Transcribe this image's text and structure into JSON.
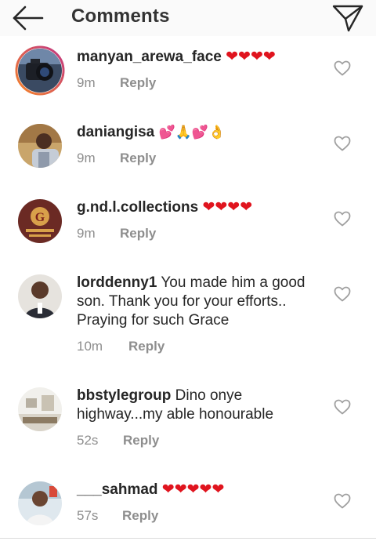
{
  "header": {
    "title": "Comments",
    "back_icon": "arrow-left-icon",
    "send_icon": "paper-plane-icon"
  },
  "colors": {
    "heart": "#e0141e",
    "meta": "#8e8e8e",
    "text": "#262626",
    "story_ring_start": "#f58529",
    "story_ring_end": "#c13584"
  },
  "comments": [
    {
      "username": "manyan_arewa_face",
      "text": "",
      "emoji": "❤❤❤❤",
      "time": "9m",
      "reply_label": "Reply",
      "has_story_ring": true
    },
    {
      "username": "daniangisa",
      "text": "",
      "emoji": "💕🙏💕👌",
      "time": "9m",
      "reply_label": "Reply"
    },
    {
      "username": "g.nd.l.collections",
      "text": "",
      "emoji": "❤❤❤❤",
      "time": "9m",
      "reply_label": "Reply"
    },
    {
      "username": "lorddenny1",
      "text": "You made him a good son. Thank you for your efforts.. Praying for such Grace",
      "emoji": "",
      "time": "10m",
      "reply_label": "Reply"
    },
    {
      "username": "bbstylegroup",
      "text": "Dino onye highway...my able honourable",
      "emoji": "",
      "time": "52s",
      "reply_label": "Reply"
    },
    {
      "username": "___sahmad",
      "text": "",
      "emoji": "❤❤❤❤❤",
      "time": "57s",
      "reply_label": "Reply"
    }
  ]
}
